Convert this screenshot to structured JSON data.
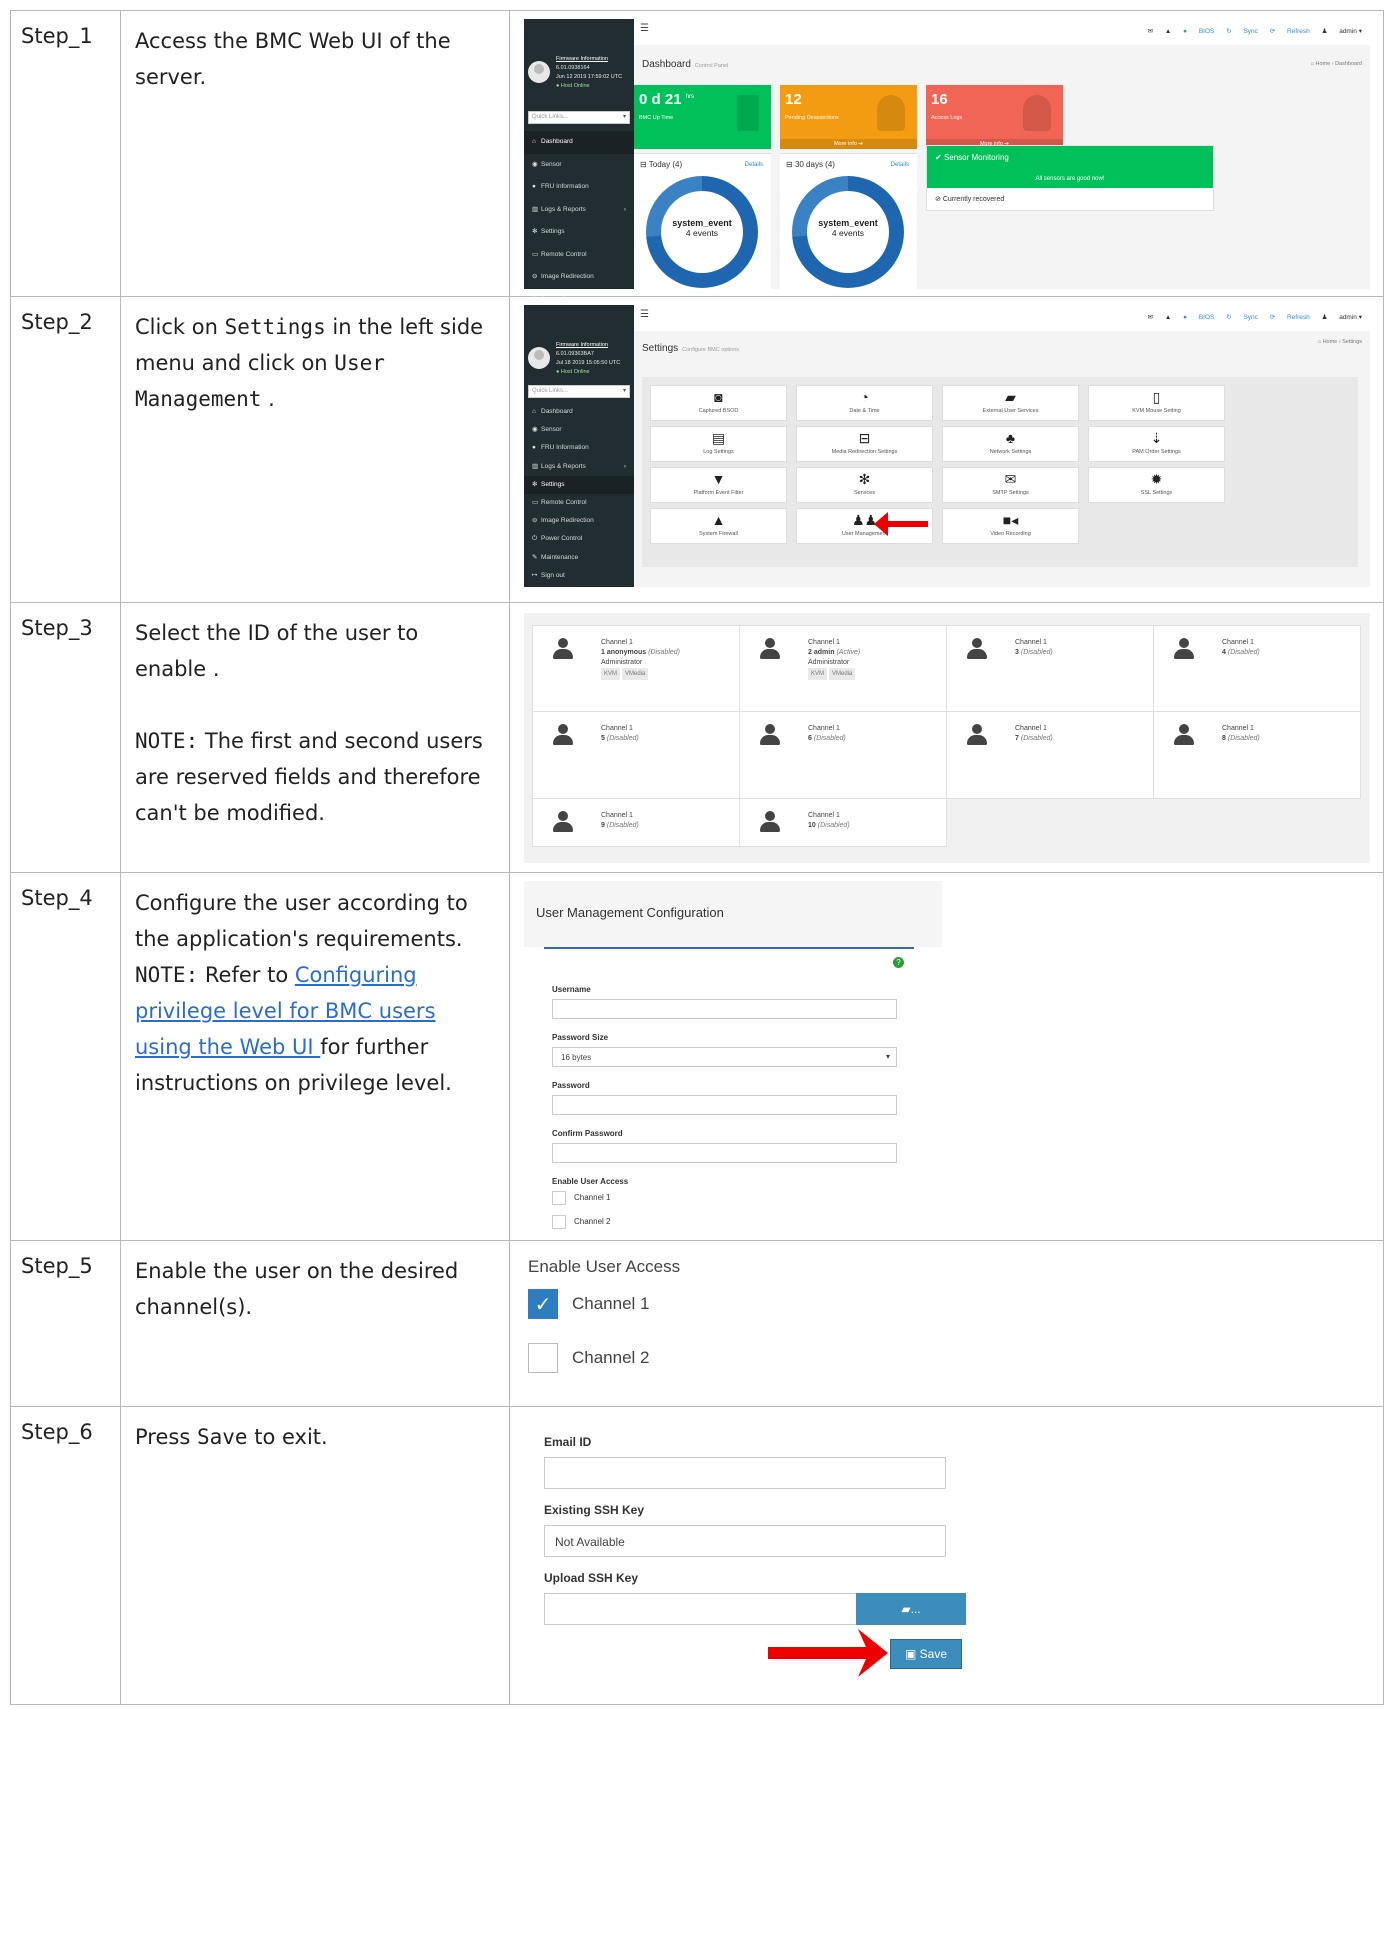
{
  "steps": [
    {
      "label": "Step_1",
      "text": "Access the BMC Web UI of the server."
    },
    {
      "label": "Step_2",
      "text_a": "Click on ",
      "b1": "Settings",
      "text_b": " in the left side menu and click on ",
      "b2": "User Management",
      "text_c": " ."
    },
    {
      "label": "Step_3",
      "text": "Select the ID of the user to enable .",
      "note_label": "NOTE:",
      "note_text": " The first and second users are reserved fields and therefore can't be modified."
    },
    {
      "label": "Step_4",
      "text": "Configure the user according to the application's requirements.",
      "note_label": "NOTE:",
      "note_a": " Refer to ",
      "link": "Configuring privilege level for BMC users using the Web UI ",
      "note_b": "for further instructions on privilege level."
    },
    {
      "label": "Step_5",
      "text": "Enable the user on the desired channel(s)."
    },
    {
      "label": "Step_6",
      "text_a": "Press ",
      "b": "Save",
      "text_b": " to exit."
    }
  ],
  "bmc": {
    "top_icons": [
      "envelope-icon",
      "warning-icon"
    ],
    "top_bios": "BIOS",
    "top_sync": "Sync",
    "top_refresh": "Refresh",
    "top_admin": "admin",
    "fw_title": "Firmware Information",
    "fw_version_1": "6.01.0938164",
    "fw_date_1": "Jun 12 2019 17:59:02 UTC",
    "fw_version_2": "6.01.09363BA7",
    "fw_date_2": "Jul 18 2019 15:05:50 UTC",
    "host_status": "Host Online",
    "quick_links": "Quick Links...",
    "menu": [
      "Dashboard",
      "Sensor",
      "FRU Information",
      "Logs & Reports",
      "Settings",
      "Remote Control",
      "Image Redirection",
      "Power Control",
      "Maintenance",
      "Sign out"
    ],
    "crumb_home": "Home",
    "crumb_dashboard": "Dashboard",
    "crumb_settings": "Settings"
  },
  "dashboard": {
    "title": "Dashboard",
    "subtitle": "Control Panel",
    "tile_uptime_value": "0 d 21",
    "tile_uptime_unit": "hrs",
    "tile_uptime_label": "BMC Up Time",
    "tile_pending_value": "12",
    "tile_pending_label": "Pending Deassertions",
    "tile_access_value": "16",
    "tile_access_label": "Access Logs",
    "more_info": "More info",
    "today_header": "Today (4)",
    "days30_header": "30 days (4)",
    "details": "Details",
    "donut_event": "system_event",
    "donut_count": "4 events",
    "sensor_title": "Sensor Monitoring",
    "sensor_good": "All sensors are good now!",
    "sensor_recovered": "Currently recovered",
    "colors": {
      "green": "#00c05a",
      "orange": "#f39c12",
      "red": "#f06554",
      "donut": "#1e66b0"
    }
  },
  "settings": {
    "title": "Settings",
    "subtitle": "Configure BMC options",
    "tiles": [
      "Captured BSOD",
      "Date & Time",
      "External User Services",
      "KVM Mouse Setting",
      "Log Settings",
      "Media Redirection Settings",
      "Network Settings",
      "PAM Order Settings",
      "Platform Event Filter",
      "Services",
      "SMTP Settings",
      "SSL Settings",
      "System Firewall",
      "User Management",
      "Video Recording"
    ]
  },
  "users": [
    {
      "channel": "Channel 1",
      "id": "1",
      "name": "anonymous",
      "state": "(Disabled)",
      "role": "Administrator",
      "badges": [
        "KVM",
        "VMedia"
      ]
    },
    {
      "channel": "Channel 1",
      "id": "2",
      "name": "admin",
      "state": "(Active)",
      "role": "Administrator",
      "badges": [
        "KVM",
        "VMedia"
      ]
    },
    {
      "channel": "Channel 1",
      "id": "3",
      "name": "",
      "state": "(Disabled)"
    },
    {
      "channel": "Channel 1",
      "id": "4",
      "name": "",
      "state": "(Disabled)"
    },
    {
      "channel": "Channel 1",
      "id": "5",
      "name": "",
      "state": "(Disabled)"
    },
    {
      "channel": "Channel 1",
      "id": "6",
      "name": "",
      "state": "(Disabled)"
    },
    {
      "channel": "Channel 1",
      "id": "7",
      "name": "",
      "state": "(Disabled)"
    },
    {
      "channel": "Channel 1",
      "id": "8",
      "name": "",
      "state": "(Disabled)"
    },
    {
      "channel": "Channel 1",
      "id": "9",
      "name": "",
      "state": "(Disabled)"
    },
    {
      "channel": "Channel 1",
      "id": "10",
      "name": "",
      "state": "(Disabled)"
    }
  ],
  "config": {
    "title": "User Management Configuration",
    "username_label": "Username",
    "password_size_label": "Password Size",
    "password_size_value": "16 bytes",
    "password_label": "Password",
    "confirm_label": "Confirm Password",
    "enable_label": "Enable User Access",
    "channel1": "Channel 1",
    "channel2": "Channel 2"
  },
  "step5": {
    "title": "Enable User Access",
    "channel1": "Channel 1",
    "channel2": "Channel 2",
    "checked": true
  },
  "step6": {
    "email_label": "Email ID",
    "existing_ssh_label": "Existing SSH Key",
    "existing_ssh_value": "Not Available",
    "upload_ssh_label": "Upload SSH Key",
    "browse": "...",
    "save": "Save"
  }
}
